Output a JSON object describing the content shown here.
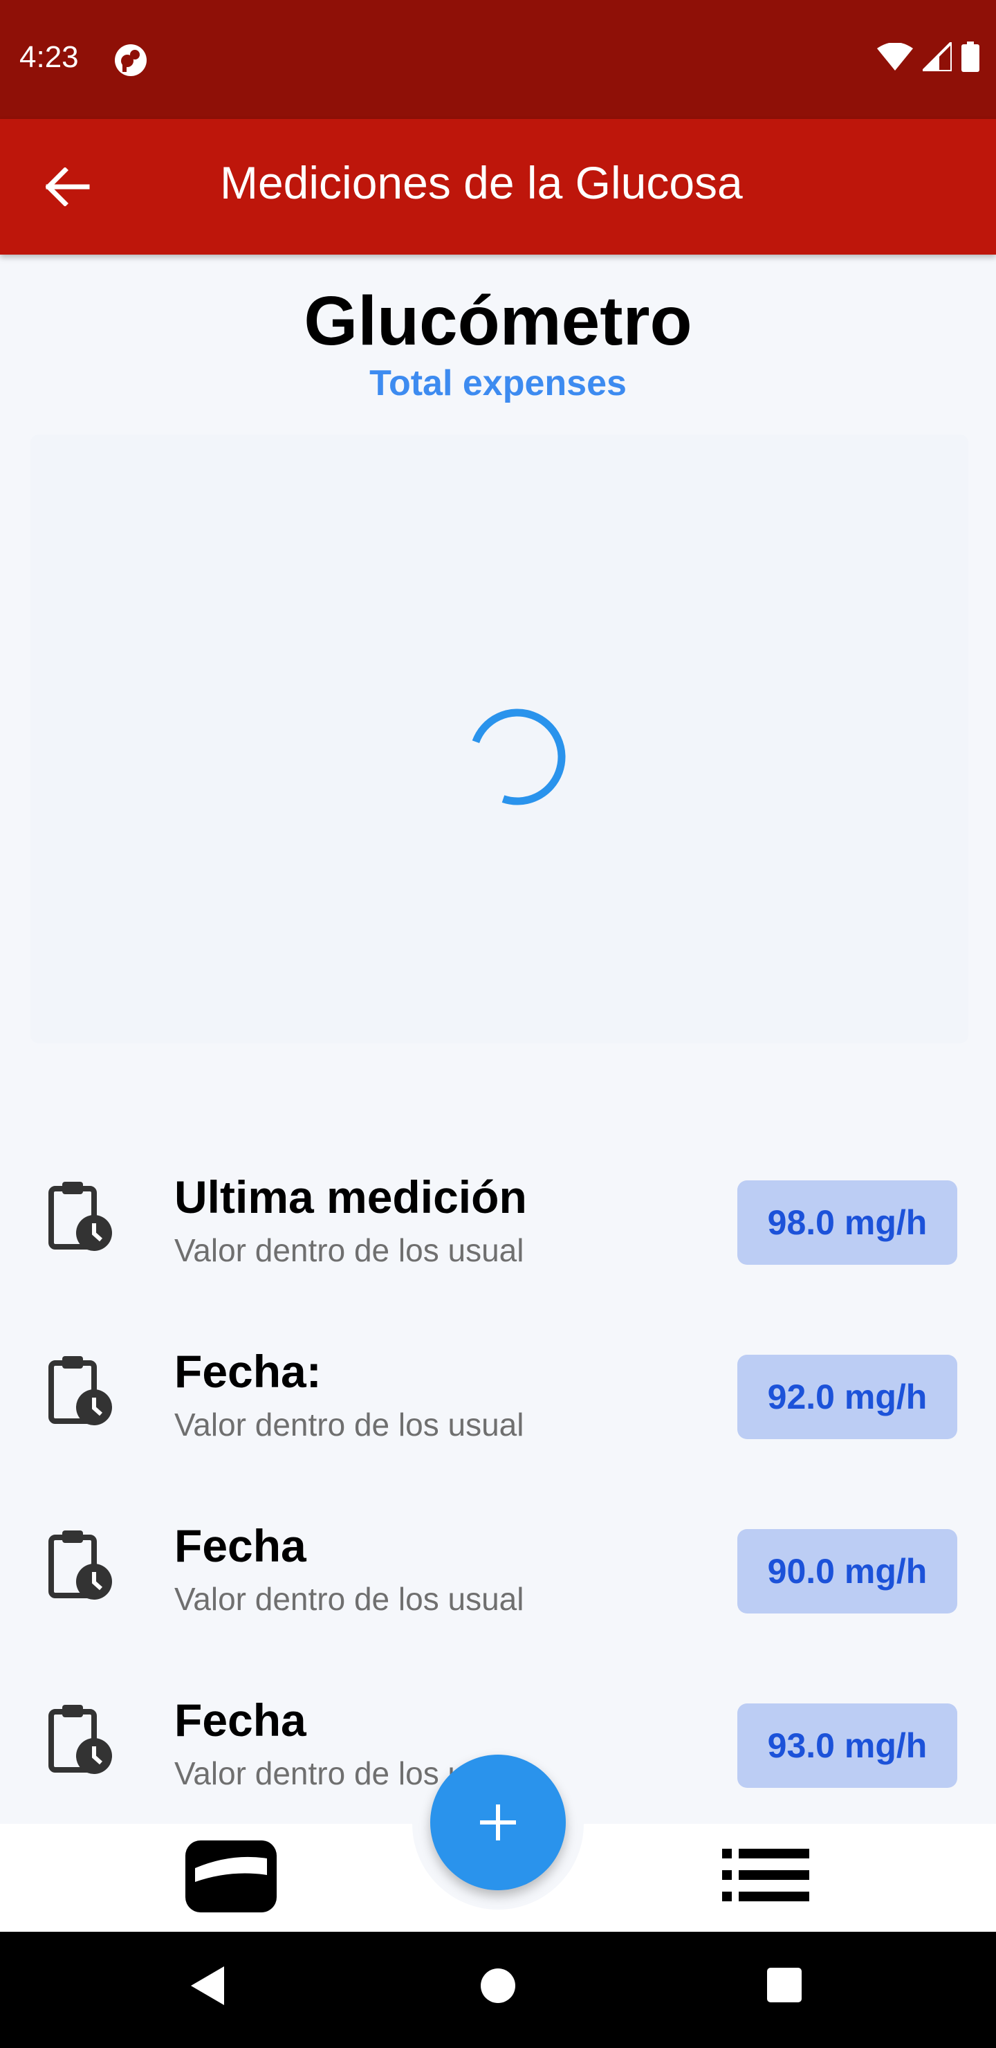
{
  "status_bar": {
    "time": "4:23"
  },
  "app_bar": {
    "title": "Mediciones de la Glucosa"
  },
  "header": {
    "title": "Glucómetro",
    "subtitle": "Total expenses"
  },
  "measurements": [
    {
      "title": "Ultima medición",
      "subtitle": "Valor dentro de los usual",
      "value": "98.0 mg/h"
    },
    {
      "title": "Fecha:",
      "subtitle": "Valor dentro de los usual",
      "value": "92.0 mg/h"
    },
    {
      "title": "Fecha",
      "subtitle": "Valor dentro de los usual",
      "value": "90.0 mg/h"
    },
    {
      "title": "Fecha",
      "subtitle": "Valor dentro de los usual",
      "value": "93.0 mg/h"
    }
  ],
  "icons": {
    "back": "arrow-left-icon",
    "measurement": "clipboard-clock-icon",
    "fab": "plus-icon",
    "nav_left": "wallet-icon",
    "nav_right": "list-icon"
  },
  "colors": {
    "status_bar": "#8f1007",
    "app_bar": "#be160b",
    "accent": "#2a93ec",
    "subtitle": "#3d8bf0",
    "badge_bg": "#bccdf4",
    "badge_text": "#1c52d9"
  }
}
